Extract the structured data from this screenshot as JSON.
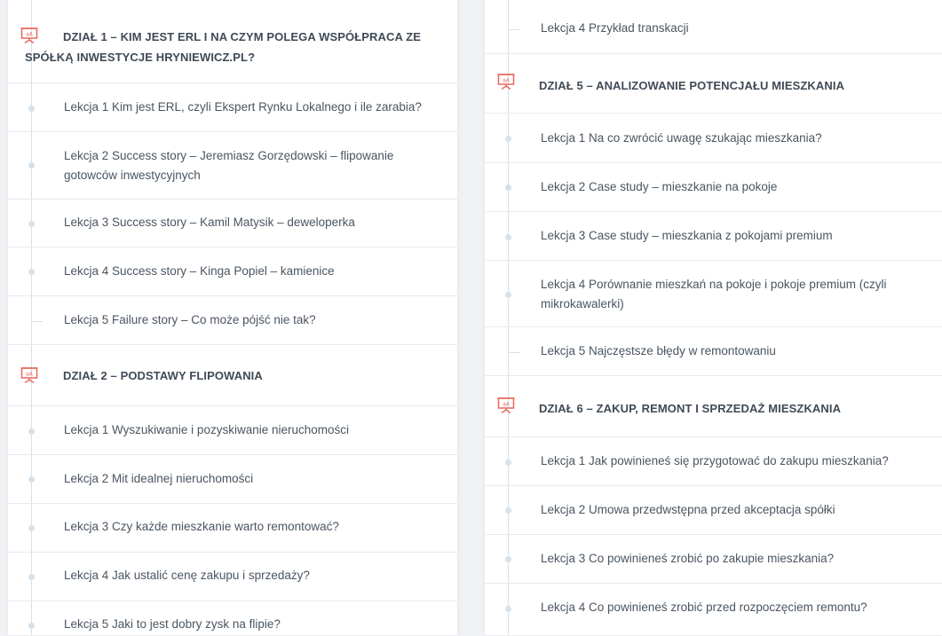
{
  "left_column": {
    "sections": [
      {
        "title": "DZIAŁ 1 – KIM JEST ERL I NA CZYM POLEGA WSPÓŁPRACA ZE SPÓŁKĄ INWESTYCJE HRYNIEWICZ.PL?",
        "icon": "presentation-board-icon",
        "lessons": [
          "Lekcja 1 Kim jest ERL, czyli Ekspert Rynku Lokalnego i ile zarabia?",
          "Lekcja 2 Success story – Jeremiasz Gorzędowski – flipowanie gotowców inwestycyjnych",
          "Lekcja 3 Success story – Kamil Matysik – deweloperka",
          "Lekcja 4 Success story – Kinga Popiel – kamienice",
          "Lekcja 5 Failure story – Co może pójść nie tak?"
        ]
      },
      {
        "title": "DZIAŁ 2 – PODSTAWY FLIPOWANIA",
        "icon": "presentation-board-icon",
        "lessons": [
          "Lekcja 1 Wyszukiwanie i pozyskiwanie nieruchomości",
          "Lekcja 2 Mit idealnej nieruchomości",
          "Lekcja 3 Czy każde mieszkanie warto remontować?",
          "Lekcja 4 Jak ustalić cenę zakupu i sprzedaży?",
          "Lekcja 5 Jaki to jest dobry zysk na flipie?"
        ]
      }
    ]
  },
  "right_column": {
    "top_lesson": "Lekcja 4 Przykład transkacji",
    "sections": [
      {
        "title": "DZIAŁ 5 – ANALIZOWANIE POTENCJAŁU MIESZKANIA",
        "icon": "presentation-board-icon",
        "lessons": [
          "Lekcja 1 Na co zwrócić uwagę szukając mieszkania?",
          "Lekcja 2 Case study – mieszkanie na pokoje",
          "Lekcja 3 Case study – mieszkania z pokojami premium",
          "Lekcja 4 Porównanie mieszkań na pokoje i pokoje premium (czyli mikrokawalerki)",
          "Lekcja 5 Najczęstsze błędy w remontowaniu"
        ]
      },
      {
        "title": "DZIAŁ 6 – ZAKUP, REMONT I SPRZEDAŻ MIESZKANIA",
        "icon": "presentation-board-icon",
        "lessons": [
          "Lekcja 1 Jak powinieneś się przygotować do zakupu mieszkania?",
          "Lekcja 2 Umowa przedwstępna przed akceptacja spółki",
          "Lekcja 3 Co powinieneś zrobić po zakupie mieszkania?",
          "Lekcja 4 Co powinieneś zrobić przed rozpoczęciem remontu?"
        ]
      }
    ]
  },
  "colors": {
    "icon": "#e8675c",
    "text": "#4a5560",
    "title": "#3f4a56",
    "tree_line": "#d6e1ea",
    "divider": "#e6ebef"
  }
}
